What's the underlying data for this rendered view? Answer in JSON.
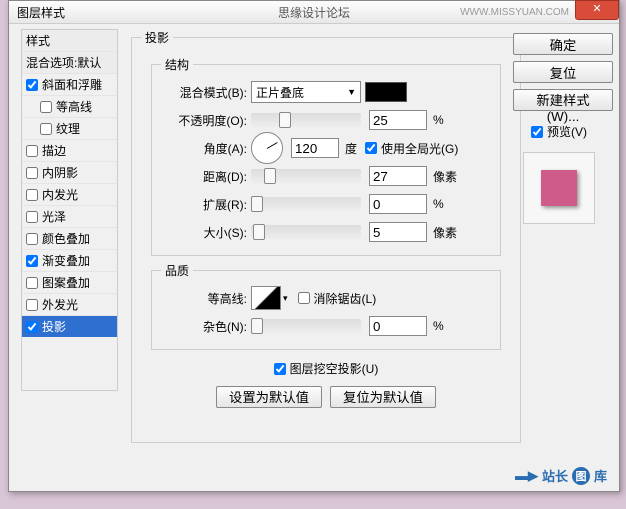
{
  "titlebar": {
    "title": "图层样式",
    "subtitle": "思缘设计论坛",
    "url": "WWW.MISSYUAN.COM",
    "close": "✕"
  },
  "styles": {
    "header": "样式",
    "blendopts": "混合选项:默认",
    "items": [
      {
        "label": "斜面和浮雕",
        "checked": true
      },
      {
        "label": "等高线",
        "checked": false,
        "indent": true
      },
      {
        "label": "纹理",
        "checked": false,
        "indent": true
      },
      {
        "label": "描边",
        "checked": false
      },
      {
        "label": "内阴影",
        "checked": false
      },
      {
        "label": "内发光",
        "checked": false
      },
      {
        "label": "光泽",
        "checked": false
      },
      {
        "label": "颜色叠加",
        "checked": false
      },
      {
        "label": "渐变叠加",
        "checked": true
      },
      {
        "label": "图案叠加",
        "checked": false
      },
      {
        "label": "外发光",
        "checked": false
      },
      {
        "label": "投影",
        "checked": true,
        "selected": true
      }
    ]
  },
  "main": {
    "title": "投影",
    "structure": {
      "legend": "结构",
      "blendmode": {
        "label": "混合模式(B):",
        "value": "正片叠底"
      },
      "opacity": {
        "label": "不透明度(O):",
        "value": "25",
        "unit": "%",
        "thumb": 25
      },
      "angle": {
        "label": "角度(A):",
        "value": "120",
        "unit": "度",
        "global": "使用全局光(G)",
        "global_checked": true
      },
      "distance": {
        "label": "距离(D):",
        "value": "27",
        "unit": "像素",
        "thumb": 12
      },
      "spread": {
        "label": "扩展(R):",
        "value": "0",
        "unit": "%",
        "thumb": 0
      },
      "size": {
        "label": "大小(S):",
        "value": "5",
        "unit": "像素",
        "thumb": 2
      }
    },
    "quality": {
      "legend": "品质",
      "contour": {
        "label": "等高线:",
        "antialias": "消除锯齿(L)",
        "antialias_checked": false
      },
      "noise": {
        "label": "杂色(N):",
        "value": "0",
        "unit": "%",
        "thumb": 0
      }
    },
    "knockout": {
      "label": "图层挖空投影(U)",
      "checked": true
    },
    "btn_default": "设置为默认值",
    "btn_reset": "复位为默认值"
  },
  "right": {
    "ok": "确定",
    "cancel": "复位",
    "newstyle": "新建样式(W)...",
    "preview": "预览(V)",
    "preview_checked": true
  },
  "watermark": {
    "text": "站长",
    "badge": "图",
    "suffix": "库"
  }
}
